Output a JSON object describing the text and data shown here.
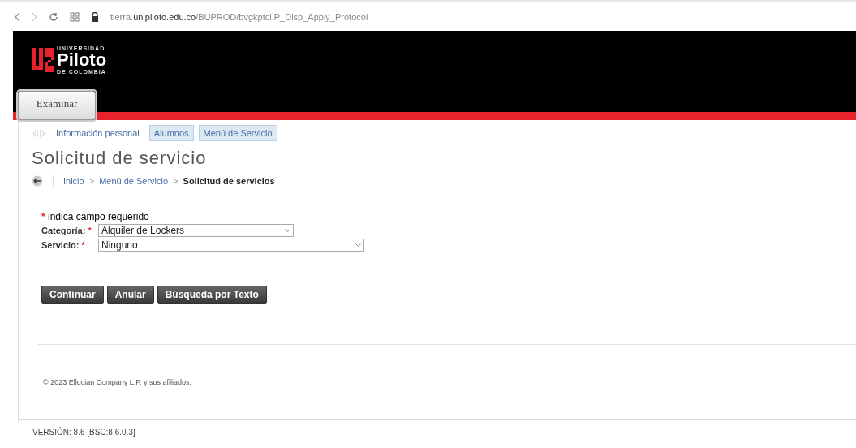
{
  "browser": {
    "url_host_prefix": "tierra.",
    "url_host_main": "unipiloto.edu.co",
    "url_path": "/BUPROD/bvgkptcl.P_Disp_Apply_Protocol"
  },
  "header": {
    "logo_top": "UNIVERSIDAD",
    "logo_name": "Piloto",
    "logo_bottom": "DE COLOMBIA",
    "menu_button": "Examinar"
  },
  "nav_tabs": [
    {
      "label": "Información personal",
      "selected": false
    },
    {
      "label": "Alumnos",
      "selected": true
    },
    {
      "label": "Menú de Servicio",
      "selected": true
    }
  ],
  "page_title": "Solicitud de servicio",
  "breadcrumb": [
    {
      "label": "Inicio",
      "current": false
    },
    {
      "label": "Menú de Servicio",
      "current": false
    },
    {
      "label": "Solicitud de servicios",
      "current": true
    }
  ],
  "breadcrumb_separator": ">",
  "required_mark": "*",
  "required_note": "indica campo requerido",
  "fields": [
    {
      "label": "Categoría:",
      "value": "Alquiler de Lockers"
    },
    {
      "label": "Servicio:",
      "value": "Ninguno"
    }
  ],
  "buttons": [
    "Continuar",
    "Anular",
    "Búsqueda por Texto"
  ],
  "footer": "© 2023 Ellucian Company L.P. y sus afiliados.",
  "version": "VERSIÓN: 8.6 [BSC:8.6.0.3]"
}
